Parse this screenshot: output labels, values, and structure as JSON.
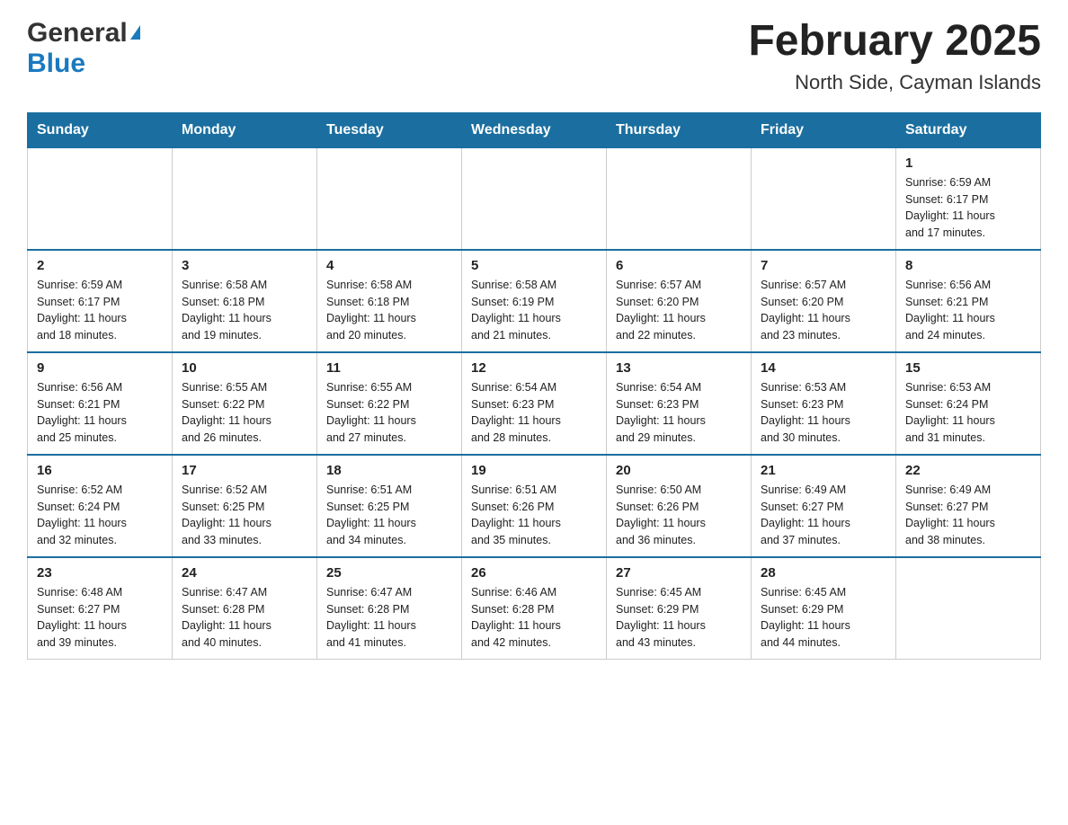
{
  "header": {
    "logo_general": "General",
    "logo_blue": "Blue",
    "title": "February 2025",
    "subtitle": "North Side, Cayman Islands"
  },
  "days_of_week": [
    "Sunday",
    "Monday",
    "Tuesday",
    "Wednesday",
    "Thursday",
    "Friday",
    "Saturday"
  ],
  "weeks": [
    [
      {
        "day": "",
        "info": ""
      },
      {
        "day": "",
        "info": ""
      },
      {
        "day": "",
        "info": ""
      },
      {
        "day": "",
        "info": ""
      },
      {
        "day": "",
        "info": ""
      },
      {
        "day": "",
        "info": ""
      },
      {
        "day": "1",
        "info": "Sunrise: 6:59 AM\nSunset: 6:17 PM\nDaylight: 11 hours\nand 17 minutes."
      }
    ],
    [
      {
        "day": "2",
        "info": "Sunrise: 6:59 AM\nSunset: 6:17 PM\nDaylight: 11 hours\nand 18 minutes."
      },
      {
        "day": "3",
        "info": "Sunrise: 6:58 AM\nSunset: 6:18 PM\nDaylight: 11 hours\nand 19 minutes."
      },
      {
        "day": "4",
        "info": "Sunrise: 6:58 AM\nSunset: 6:18 PM\nDaylight: 11 hours\nand 20 minutes."
      },
      {
        "day": "5",
        "info": "Sunrise: 6:58 AM\nSunset: 6:19 PM\nDaylight: 11 hours\nand 21 minutes."
      },
      {
        "day": "6",
        "info": "Sunrise: 6:57 AM\nSunset: 6:20 PM\nDaylight: 11 hours\nand 22 minutes."
      },
      {
        "day": "7",
        "info": "Sunrise: 6:57 AM\nSunset: 6:20 PM\nDaylight: 11 hours\nand 23 minutes."
      },
      {
        "day": "8",
        "info": "Sunrise: 6:56 AM\nSunset: 6:21 PM\nDaylight: 11 hours\nand 24 minutes."
      }
    ],
    [
      {
        "day": "9",
        "info": "Sunrise: 6:56 AM\nSunset: 6:21 PM\nDaylight: 11 hours\nand 25 minutes."
      },
      {
        "day": "10",
        "info": "Sunrise: 6:55 AM\nSunset: 6:22 PM\nDaylight: 11 hours\nand 26 minutes."
      },
      {
        "day": "11",
        "info": "Sunrise: 6:55 AM\nSunset: 6:22 PM\nDaylight: 11 hours\nand 27 minutes."
      },
      {
        "day": "12",
        "info": "Sunrise: 6:54 AM\nSunset: 6:23 PM\nDaylight: 11 hours\nand 28 minutes."
      },
      {
        "day": "13",
        "info": "Sunrise: 6:54 AM\nSunset: 6:23 PM\nDaylight: 11 hours\nand 29 minutes."
      },
      {
        "day": "14",
        "info": "Sunrise: 6:53 AM\nSunset: 6:23 PM\nDaylight: 11 hours\nand 30 minutes."
      },
      {
        "day": "15",
        "info": "Sunrise: 6:53 AM\nSunset: 6:24 PM\nDaylight: 11 hours\nand 31 minutes."
      }
    ],
    [
      {
        "day": "16",
        "info": "Sunrise: 6:52 AM\nSunset: 6:24 PM\nDaylight: 11 hours\nand 32 minutes."
      },
      {
        "day": "17",
        "info": "Sunrise: 6:52 AM\nSunset: 6:25 PM\nDaylight: 11 hours\nand 33 minutes."
      },
      {
        "day": "18",
        "info": "Sunrise: 6:51 AM\nSunset: 6:25 PM\nDaylight: 11 hours\nand 34 minutes."
      },
      {
        "day": "19",
        "info": "Sunrise: 6:51 AM\nSunset: 6:26 PM\nDaylight: 11 hours\nand 35 minutes."
      },
      {
        "day": "20",
        "info": "Sunrise: 6:50 AM\nSunset: 6:26 PM\nDaylight: 11 hours\nand 36 minutes."
      },
      {
        "day": "21",
        "info": "Sunrise: 6:49 AM\nSunset: 6:27 PM\nDaylight: 11 hours\nand 37 minutes."
      },
      {
        "day": "22",
        "info": "Sunrise: 6:49 AM\nSunset: 6:27 PM\nDaylight: 11 hours\nand 38 minutes."
      }
    ],
    [
      {
        "day": "23",
        "info": "Sunrise: 6:48 AM\nSunset: 6:27 PM\nDaylight: 11 hours\nand 39 minutes."
      },
      {
        "day": "24",
        "info": "Sunrise: 6:47 AM\nSunset: 6:28 PM\nDaylight: 11 hours\nand 40 minutes."
      },
      {
        "day": "25",
        "info": "Sunrise: 6:47 AM\nSunset: 6:28 PM\nDaylight: 11 hours\nand 41 minutes."
      },
      {
        "day": "26",
        "info": "Sunrise: 6:46 AM\nSunset: 6:28 PM\nDaylight: 11 hours\nand 42 minutes."
      },
      {
        "day": "27",
        "info": "Sunrise: 6:45 AM\nSunset: 6:29 PM\nDaylight: 11 hours\nand 43 minutes."
      },
      {
        "day": "28",
        "info": "Sunrise: 6:45 AM\nSunset: 6:29 PM\nDaylight: 11 hours\nand 44 minutes."
      },
      {
        "day": "",
        "info": ""
      }
    ]
  ]
}
